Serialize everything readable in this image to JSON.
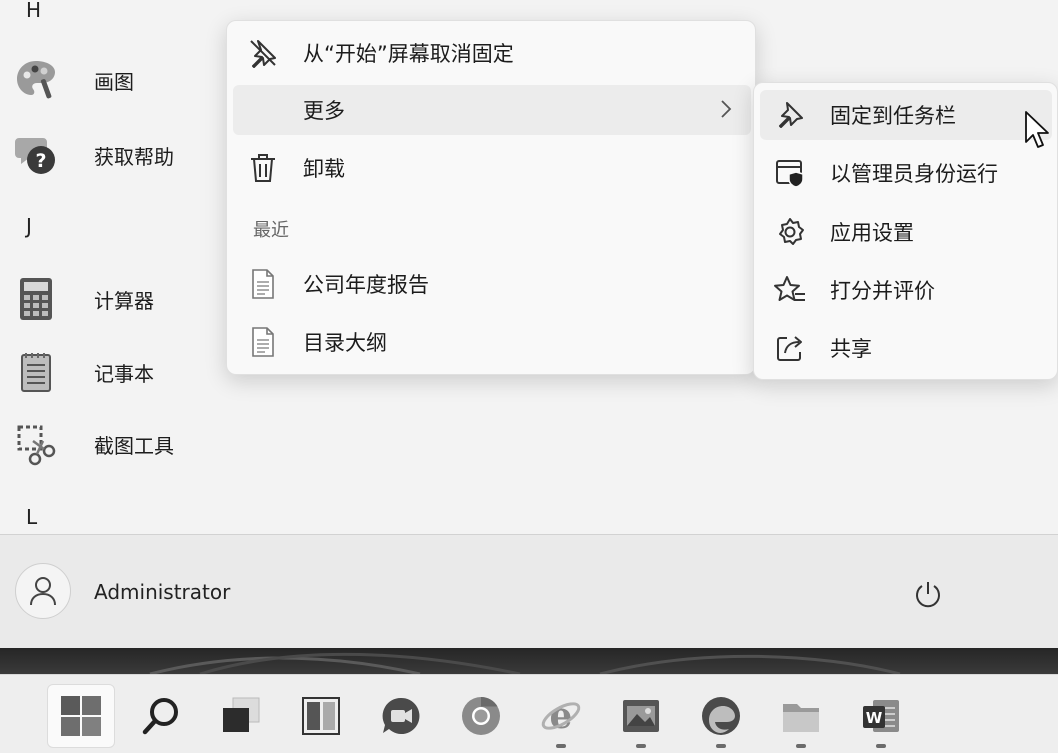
{
  "app_list": {
    "letters": [
      "H",
      "J",
      "L"
    ],
    "apps": [
      {
        "label": "画图",
        "icon": "paint-palette-icon"
      },
      {
        "label": "获取帮助",
        "icon": "get-help-icon"
      },
      {
        "label": "计算器",
        "icon": "calculator-icon"
      },
      {
        "label": "记事本",
        "icon": "notepad-icon"
      },
      {
        "label": "截图工具",
        "icon": "snipping-tool-icon"
      }
    ]
  },
  "context_menu": {
    "unpin_label": "从“开始”屏幕取消固定",
    "more_label": "更多",
    "uninstall_label": "卸载",
    "recent_title": "最近",
    "recent_files": [
      "公司年度报告",
      "目录大纲"
    ]
  },
  "submenu": {
    "items": [
      {
        "label": "固定到任务栏",
        "icon": "pin-icon"
      },
      {
        "label": "以管理员身份运行",
        "icon": "admin-shield-icon"
      },
      {
        "label": "应用设置",
        "icon": "gear-icon"
      },
      {
        "label": "打分并评价",
        "icon": "rate-star-icon"
      },
      {
        "label": "共享",
        "icon": "share-icon"
      }
    ]
  },
  "user_bar": {
    "user_name": "Administrator"
  },
  "taskbar": {
    "items": [
      {
        "icon": "windows-start-icon",
        "running": false
      },
      {
        "icon": "search-icon",
        "running": false
      },
      {
        "icon": "task-view-icon",
        "running": false
      },
      {
        "icon": "widgets-icon",
        "running": false
      },
      {
        "icon": "chat-icon",
        "running": false
      },
      {
        "icon": "chrome-icon",
        "running": false
      },
      {
        "icon": "internet-explorer-icon",
        "running": true
      },
      {
        "icon": "photos-icon",
        "running": true
      },
      {
        "icon": "edge-icon",
        "running": true
      },
      {
        "icon": "file-explorer-icon",
        "running": true
      },
      {
        "icon": "word-icon",
        "running": true
      }
    ]
  }
}
